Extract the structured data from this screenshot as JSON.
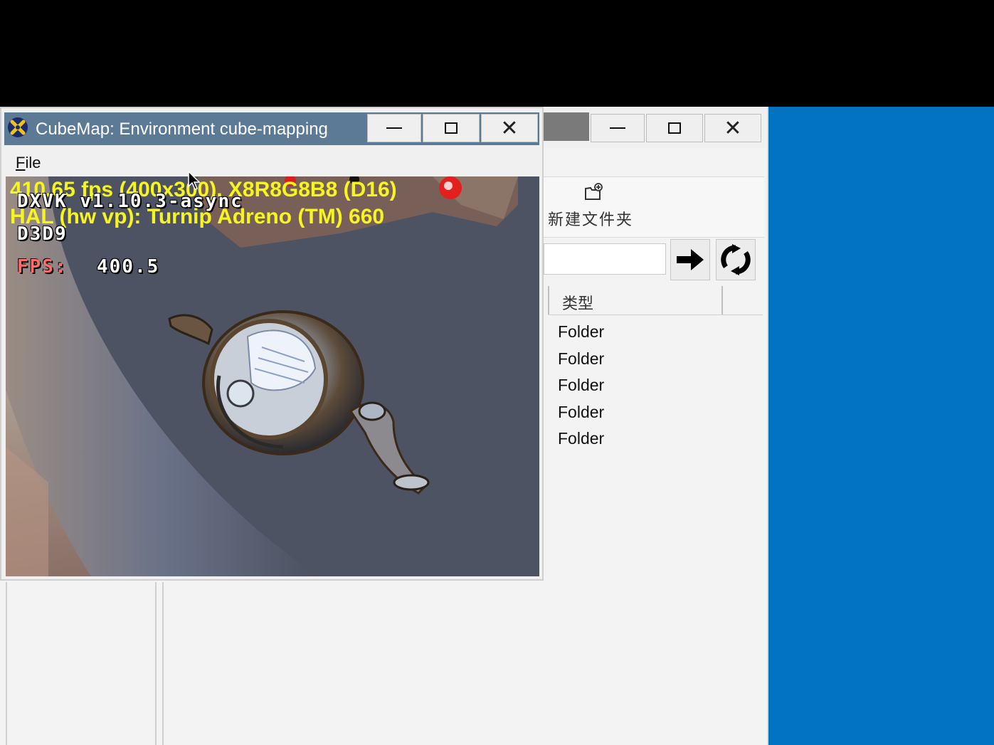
{
  "cubemap_window": {
    "title": "CubeMap: Environment cube-mapping",
    "menu": {
      "file_prefix": "F",
      "file_rest": "ile"
    },
    "hud": {
      "stats_line": "410.65 fps (400x300), X8R8G8B8 (D16)",
      "device_line": "HAL (hw vp): Turnip Adreno (TM) 660",
      "dxvk_version": "DXVK v1.10.3-async",
      "api": "D3D9",
      "fps_label": "FPS:",
      "fps_value": "400.5"
    },
    "controls": {
      "minimize": "–",
      "maximize": "☐",
      "close": "✕"
    }
  },
  "explorer_window": {
    "new_folder_label": "新建文件夹",
    "new_folder_icon": "new-folder-icon",
    "address_value": "",
    "go_icon": "arrow-right-icon",
    "refresh_icon": "refresh-icon",
    "column_header": "类型",
    "items": [
      {
        "type": "Folder"
      },
      {
        "type": "Folder"
      },
      {
        "type": "Folder"
      },
      {
        "type": "Folder"
      },
      {
        "type": "Folder"
      }
    ],
    "close_glyph": "✕"
  },
  "colors": {
    "desktop_blue": "#0173c0",
    "titlebar": "#5c7a95",
    "hud_yellow": "#f7f51e",
    "hud_red": "#ff6a6a"
  }
}
